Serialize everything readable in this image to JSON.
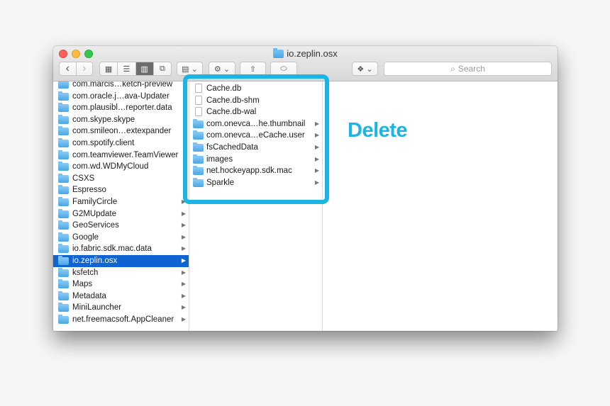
{
  "window": {
    "title": "io.zeplin.osx"
  },
  "toolbar": {
    "back_icon": "‹",
    "forward_icon": "›",
    "view_icons": "▦",
    "view_list": "☰",
    "view_columns": "▥",
    "view_coverflow": "⧉",
    "arrange": "▤ ⌄",
    "action": "⚙ ⌄",
    "share": "⇧",
    "tag": "⬭",
    "dropbox": "❖ ⌄",
    "search_placeholder": "Search"
  },
  "column1": [
    {
      "name": "com.marcis…ketch-preview",
      "folder": true,
      "arrow": false
    },
    {
      "name": "com.oracle.j…ava-Updater",
      "folder": true,
      "arrow": false
    },
    {
      "name": "com.plausibl…reporter.data",
      "folder": true,
      "arrow": false
    },
    {
      "name": "com.skype.skype",
      "folder": true,
      "arrow": false
    },
    {
      "name": "com.smileon…extexpander",
      "folder": true,
      "arrow": false
    },
    {
      "name": "com.spotify.client",
      "folder": true,
      "arrow": false
    },
    {
      "name": "com.teamviewer.TeamViewer",
      "folder": true,
      "arrow": false
    },
    {
      "name": "com.wd.WDMyCloud",
      "folder": true,
      "arrow": false
    },
    {
      "name": "CSXS",
      "folder": true,
      "arrow": false
    },
    {
      "name": "Espresso",
      "folder": true,
      "arrow": false
    },
    {
      "name": "FamilyCircle",
      "folder": true,
      "arrow": true
    },
    {
      "name": "G2MUpdate",
      "folder": true,
      "arrow": true
    },
    {
      "name": "GeoServices",
      "folder": true,
      "arrow": true
    },
    {
      "name": "Google",
      "folder": true,
      "arrow": true
    },
    {
      "name": "io.fabric.sdk.mac.data",
      "folder": true,
      "arrow": true
    },
    {
      "name": "io.zeplin.osx",
      "folder": true,
      "arrow": true,
      "selected": true
    },
    {
      "name": "ksfetch",
      "folder": true,
      "arrow": true
    },
    {
      "name": "Maps",
      "folder": true,
      "arrow": true
    },
    {
      "name": "Metadata",
      "folder": true,
      "arrow": true
    },
    {
      "name": "MiniLauncher",
      "folder": true,
      "arrow": true
    },
    {
      "name": "net.freemacsoft.AppCleaner",
      "folder": true,
      "arrow": true
    }
  ],
  "column2": [
    {
      "name": "Cache.db",
      "folder": false,
      "arrow": false
    },
    {
      "name": "Cache.db-shm",
      "folder": false,
      "arrow": false
    },
    {
      "name": "Cache.db-wal",
      "folder": false,
      "arrow": false
    },
    {
      "name": "com.onevca…he.thumbnail",
      "folder": true,
      "arrow": true
    },
    {
      "name": "com.onevca…eCache.user",
      "folder": true,
      "arrow": true
    },
    {
      "name": "fsCachedData",
      "folder": true,
      "arrow": true
    },
    {
      "name": "images",
      "folder": true,
      "arrow": true
    },
    {
      "name": "net.hockeyapp.sdk.mac",
      "folder": true,
      "arrow": true
    },
    {
      "name": "Sparkle",
      "folder": true,
      "arrow": true
    }
  ],
  "annotation": {
    "label": "Delete",
    "color": "#1ab5e4"
  },
  "colors": {
    "selection": "#0f64d2",
    "folder": "#4aa6e5"
  }
}
